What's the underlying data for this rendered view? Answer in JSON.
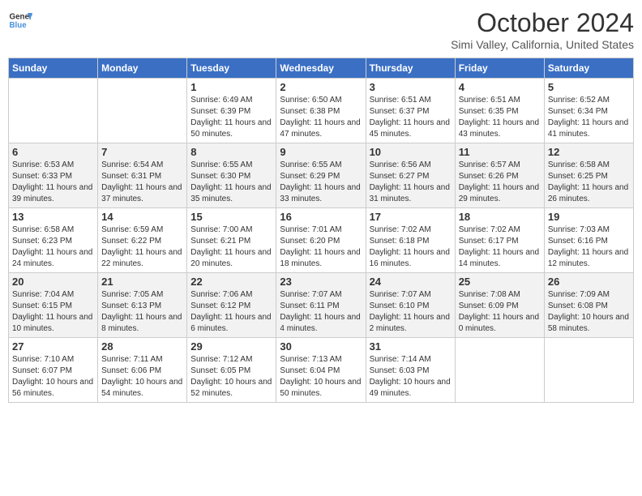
{
  "header": {
    "logo_line1": "General",
    "logo_line2": "Blue",
    "month": "October 2024",
    "location": "Simi Valley, California, United States"
  },
  "days_of_week": [
    "Sunday",
    "Monday",
    "Tuesday",
    "Wednesday",
    "Thursday",
    "Friday",
    "Saturday"
  ],
  "weeks": [
    [
      {
        "day": "",
        "info": ""
      },
      {
        "day": "",
        "info": ""
      },
      {
        "day": "1",
        "info": "Sunrise: 6:49 AM\nSunset: 6:39 PM\nDaylight: 11 hours and 50 minutes."
      },
      {
        "day": "2",
        "info": "Sunrise: 6:50 AM\nSunset: 6:38 PM\nDaylight: 11 hours and 47 minutes."
      },
      {
        "day": "3",
        "info": "Sunrise: 6:51 AM\nSunset: 6:37 PM\nDaylight: 11 hours and 45 minutes."
      },
      {
        "day": "4",
        "info": "Sunrise: 6:51 AM\nSunset: 6:35 PM\nDaylight: 11 hours and 43 minutes."
      },
      {
        "day": "5",
        "info": "Sunrise: 6:52 AM\nSunset: 6:34 PM\nDaylight: 11 hours and 41 minutes."
      }
    ],
    [
      {
        "day": "6",
        "info": "Sunrise: 6:53 AM\nSunset: 6:33 PM\nDaylight: 11 hours and 39 minutes."
      },
      {
        "day": "7",
        "info": "Sunrise: 6:54 AM\nSunset: 6:31 PM\nDaylight: 11 hours and 37 minutes."
      },
      {
        "day": "8",
        "info": "Sunrise: 6:55 AM\nSunset: 6:30 PM\nDaylight: 11 hours and 35 minutes."
      },
      {
        "day": "9",
        "info": "Sunrise: 6:55 AM\nSunset: 6:29 PM\nDaylight: 11 hours and 33 minutes."
      },
      {
        "day": "10",
        "info": "Sunrise: 6:56 AM\nSunset: 6:27 PM\nDaylight: 11 hours and 31 minutes."
      },
      {
        "day": "11",
        "info": "Sunrise: 6:57 AM\nSunset: 6:26 PM\nDaylight: 11 hours and 29 minutes."
      },
      {
        "day": "12",
        "info": "Sunrise: 6:58 AM\nSunset: 6:25 PM\nDaylight: 11 hours and 26 minutes."
      }
    ],
    [
      {
        "day": "13",
        "info": "Sunrise: 6:58 AM\nSunset: 6:23 PM\nDaylight: 11 hours and 24 minutes."
      },
      {
        "day": "14",
        "info": "Sunrise: 6:59 AM\nSunset: 6:22 PM\nDaylight: 11 hours and 22 minutes."
      },
      {
        "day": "15",
        "info": "Sunrise: 7:00 AM\nSunset: 6:21 PM\nDaylight: 11 hours and 20 minutes."
      },
      {
        "day": "16",
        "info": "Sunrise: 7:01 AM\nSunset: 6:20 PM\nDaylight: 11 hours and 18 minutes."
      },
      {
        "day": "17",
        "info": "Sunrise: 7:02 AM\nSunset: 6:18 PM\nDaylight: 11 hours and 16 minutes."
      },
      {
        "day": "18",
        "info": "Sunrise: 7:02 AM\nSunset: 6:17 PM\nDaylight: 11 hours and 14 minutes."
      },
      {
        "day": "19",
        "info": "Sunrise: 7:03 AM\nSunset: 6:16 PM\nDaylight: 11 hours and 12 minutes."
      }
    ],
    [
      {
        "day": "20",
        "info": "Sunrise: 7:04 AM\nSunset: 6:15 PM\nDaylight: 11 hours and 10 minutes."
      },
      {
        "day": "21",
        "info": "Sunrise: 7:05 AM\nSunset: 6:13 PM\nDaylight: 11 hours and 8 minutes."
      },
      {
        "day": "22",
        "info": "Sunrise: 7:06 AM\nSunset: 6:12 PM\nDaylight: 11 hours and 6 minutes."
      },
      {
        "day": "23",
        "info": "Sunrise: 7:07 AM\nSunset: 6:11 PM\nDaylight: 11 hours and 4 minutes."
      },
      {
        "day": "24",
        "info": "Sunrise: 7:07 AM\nSunset: 6:10 PM\nDaylight: 11 hours and 2 minutes."
      },
      {
        "day": "25",
        "info": "Sunrise: 7:08 AM\nSunset: 6:09 PM\nDaylight: 11 hours and 0 minutes."
      },
      {
        "day": "26",
        "info": "Sunrise: 7:09 AM\nSunset: 6:08 PM\nDaylight: 10 hours and 58 minutes."
      }
    ],
    [
      {
        "day": "27",
        "info": "Sunrise: 7:10 AM\nSunset: 6:07 PM\nDaylight: 10 hours and 56 minutes."
      },
      {
        "day": "28",
        "info": "Sunrise: 7:11 AM\nSunset: 6:06 PM\nDaylight: 10 hours and 54 minutes."
      },
      {
        "day": "29",
        "info": "Sunrise: 7:12 AM\nSunset: 6:05 PM\nDaylight: 10 hours and 52 minutes."
      },
      {
        "day": "30",
        "info": "Sunrise: 7:13 AM\nSunset: 6:04 PM\nDaylight: 10 hours and 50 minutes."
      },
      {
        "day": "31",
        "info": "Sunrise: 7:14 AM\nSunset: 6:03 PM\nDaylight: 10 hours and 49 minutes."
      },
      {
        "day": "",
        "info": ""
      },
      {
        "day": "",
        "info": ""
      }
    ]
  ]
}
